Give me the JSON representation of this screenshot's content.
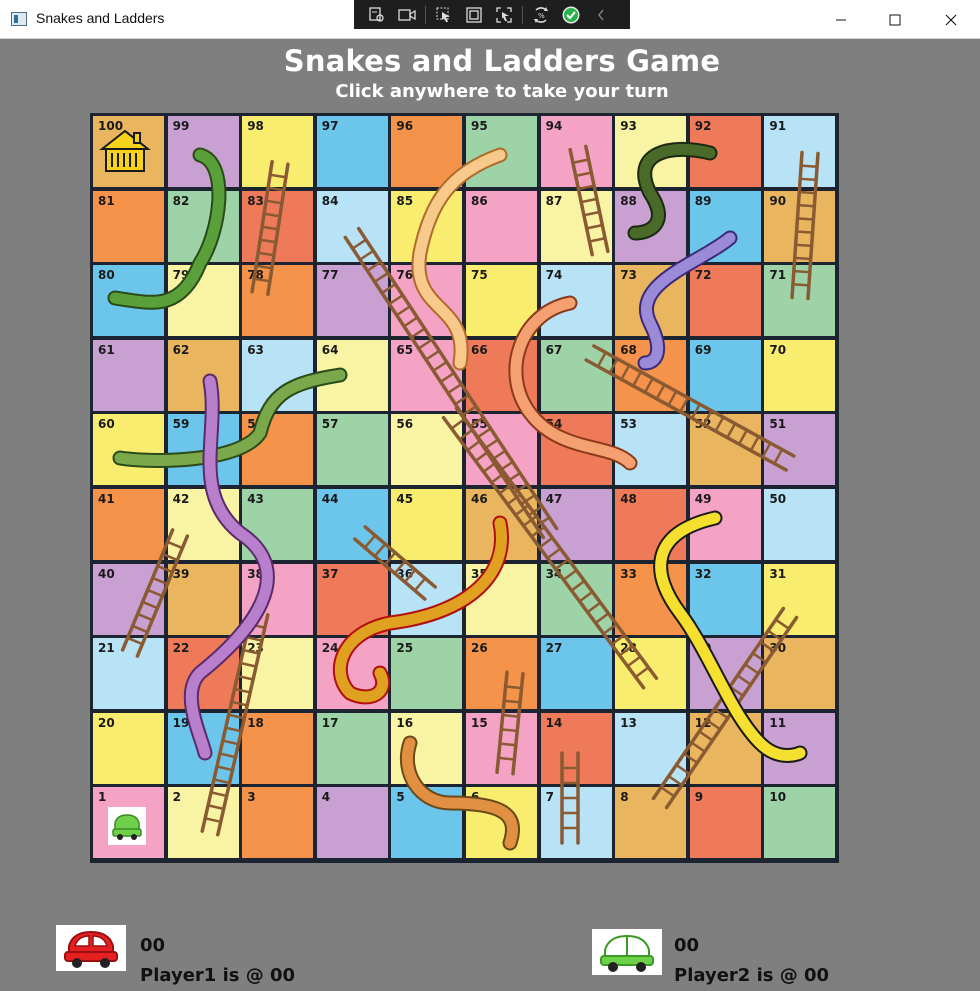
{
  "window": {
    "title": "Snakes and Ladders",
    "controls": [
      "minimize",
      "maximize",
      "close"
    ]
  },
  "debug_toolbar": {
    "icons": [
      "live-visual-tree-icon",
      "camera-icon",
      "select-element-icon",
      "layout-adorners-icon",
      "track-focus-icon",
      "hot-reload-icon",
      "check-icon",
      "collapse-chevron-icon"
    ]
  },
  "header": {
    "title": "Snakes and Ladders Game",
    "subtitle": "Click anywhere to take your turn"
  },
  "board": {
    "rows": [
      [
        100,
        99,
        98,
        97,
        96,
        95,
        94,
        93,
        92,
        91
      ],
      [
        81,
        82,
        83,
        84,
        85,
        86,
        87,
        88,
        89,
        90
      ],
      [
        80,
        79,
        78,
        77,
        76,
        75,
        74,
        73,
        72,
        71
      ],
      [
        61,
        62,
        63,
        64,
        65,
        66,
        67,
        68,
        69,
        70
      ],
      [
        60,
        59,
        58,
        57,
        56,
        55,
        54,
        53,
        52,
        51
      ],
      [
        41,
        42,
        43,
        44,
        45,
        46,
        47,
        48,
        49,
        50
      ],
      [
        40,
        39,
        38,
        37,
        36,
        35,
        34,
        33,
        32,
        31
      ],
      [
        21,
        22,
        23,
        24,
        25,
        26,
        27,
        28,
        29,
        30
      ],
      [
        20,
        19,
        18,
        17,
        16,
        15,
        14,
        13,
        12,
        11
      ],
      [
        1,
        2,
        3,
        4,
        5,
        6,
        7,
        8,
        9,
        10
      ]
    ],
    "colors": [
      [
        "#e9b65f",
        "#c9a0d2",
        "#f9ed6f",
        "#6cc6eb",
        "#f5934a",
        "#9ed3a8",
        "#f4a3c5",
        "#f9f3a4",
        "#ef7a5a",
        "#b8e2f6"
      ],
      [
        "#f5934a",
        "#9ed3a8",
        "#ef7a5a",
        "#b8e2f6",
        "#f9ed6f",
        "#f4a3c5",
        "#f9f3a4",
        "#c9a0d2",
        "#6cc6eb",
        "#e9b65f"
      ],
      [
        "#6cc6eb",
        "#f9f3a4",
        "#f5934a",
        "#c9a0d2",
        "#f4a3c5",
        "#f9ed6f",
        "#b8e2f6",
        "#e9b65f",
        "#ef7a5a",
        "#9ed3a8"
      ],
      [
        "#c9a0d2",
        "#e9b65f",
        "#b8e2f6",
        "#f9f3a4",
        "#f4a3c5",
        "#ef7a5a",
        "#9ed3a8",
        "#f5934a",
        "#6cc6eb",
        "#f9ed6f"
      ],
      [
        "#f9ed6f",
        "#6cc6eb",
        "#f5934a",
        "#9ed3a8",
        "#f9f3a4",
        "#f4a3c5",
        "#ef7a5a",
        "#b8e2f6",
        "#e9b65f",
        "#c9a0d2"
      ],
      [
        "#f5934a",
        "#f9f3a4",
        "#9ed3a8",
        "#6cc6eb",
        "#f9ed6f",
        "#e9b65f",
        "#c9a0d2",
        "#ef7a5a",
        "#f4a3c5",
        "#b8e2f6"
      ],
      [
        "#c9a0d2",
        "#e9b65f",
        "#f4a3c5",
        "#ef7a5a",
        "#b8e2f6",
        "#f9f3a4",
        "#9ed3a8",
        "#f5934a",
        "#6cc6eb",
        "#f9ed6f"
      ],
      [
        "#b8e2f6",
        "#ef7a5a",
        "#f9f3a4",
        "#f4a3c5",
        "#9ed3a8",
        "#f5934a",
        "#6cc6eb",
        "#f9ed6f",
        "#c9a0d2",
        "#e9b65f"
      ],
      [
        "#f9ed6f",
        "#6cc6eb",
        "#f5934a",
        "#9ed3a8",
        "#f9f3a4",
        "#f4a3c5",
        "#ef7a5a",
        "#b8e2f6",
        "#e9b65f",
        "#c9a0d2"
      ],
      [
        "#f4a3c5",
        "#f9f3a4",
        "#f5934a",
        "#c9a0d2",
        "#6cc6eb",
        "#f9ed6f",
        "#b8e2f6",
        "#e9b65f",
        "#ef7a5a",
        "#9ed3a8"
      ]
    ],
    "grid_line_color": "#1b2430",
    "home_icon": "house-icon",
    "token_on_square": 1
  },
  "players": [
    {
      "score": "00",
      "status": "Player1 is @ 00",
      "car_color": "#e02020",
      "icon": "red-car-icon"
    },
    {
      "score": "00",
      "status": "Player2 is @ 00",
      "car_color": "#5cc63a",
      "icon": "green-car-icon"
    }
  ]
}
